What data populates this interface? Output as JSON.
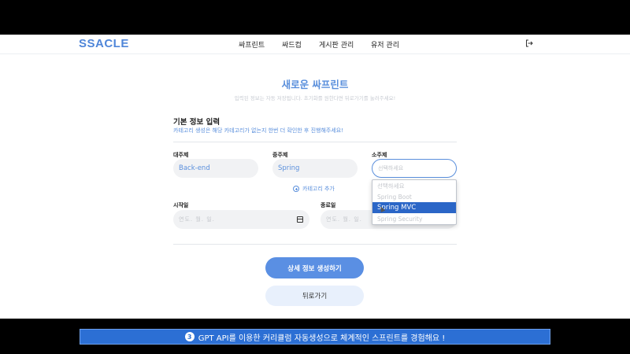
{
  "navbar": {
    "logo": "SSACLE",
    "items": [
      "싸프린트",
      "싸드컵",
      "게시판 관리",
      "유저 관리"
    ],
    "logout_icon": "logout-icon"
  },
  "header": {
    "title": "새로운 싸프린트",
    "subtitle": "입력된 정보는 자동 저장됩니다. 초기화를 원한다면 뒤로가기를 눌러주세요!"
  },
  "basic_info": {
    "title": "기본 정보 입력",
    "hint": "카테고리 생성은 해당 카테고리가 없는지 한번 더 확인한 후 진행해주세요!"
  },
  "categories": {
    "major": {
      "label": "대주제",
      "value": "Back-end"
    },
    "middle": {
      "label": "중주제",
      "value": "Spring"
    },
    "minor": {
      "label": "소주제",
      "placeholder": "선택하세요"
    },
    "add_label": "카테고리 추가"
  },
  "dropdown": {
    "options": [
      "선택하세요",
      "Spring Boot",
      "Spring MVC",
      "Spring Security"
    ],
    "highlighted_index": 2
  },
  "dates": {
    "start": {
      "label": "시작일",
      "placeholder": "연도. 월. 일."
    },
    "end": {
      "label": "종료일",
      "placeholder": "연도. 월. 일."
    }
  },
  "buttons": {
    "create": "상세 정보 생성하기",
    "back": "뒤로가기"
  },
  "caption": {
    "number": "3",
    "text": "GPT API를 이용한 커리큘럼 자동생성으로 체계적인 스프린트를 경험해요 !"
  },
  "colors": {
    "accent": "#5a8fdc",
    "selected": "#2b66c7",
    "caption_bg": "#2c6fd4"
  }
}
